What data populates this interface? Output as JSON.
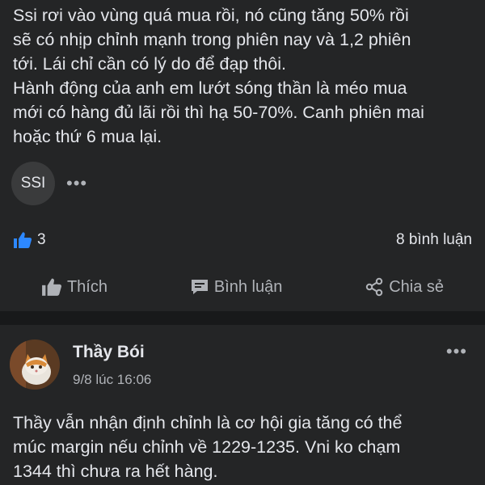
{
  "post1": {
    "text": "Ssi rơi vào vùng quá mua rồi, nó cũng tăng 50% rồi\nsẽ có nhịp chỉnh mạnh trong phiên nay và 1,2 phiên\ntới. Lái chỉ cần có lý do để đạp thôi.\nHành động của anh em lướt sóng thần là méo mua\nmới có hàng đủ lãi rồi thì hạ 50-70%. Canh phiên mai\nhoặc thứ 6 mua lại.",
    "tag": "SSI",
    "more": "•••",
    "like_count": "3",
    "comment_count": "8 bình luận",
    "actions": {
      "like": "Thích",
      "comment": "Bình luận",
      "share": "Chia sẻ"
    }
  },
  "post2": {
    "author": "Thầy Bói",
    "time": "9/8 lúc 16:06",
    "more": "•••",
    "text": "Thầy vẫn nhận định chỉnh là cơ hội gia tăng có thể\nmúc margin nếu chỉnh về 1229-1235. Vni ko chạm\n1344 thì chưa ra hết hàng."
  },
  "colors": {
    "background": "#18191a",
    "card": "#242526",
    "text": "#e4e6eb",
    "muted": "#b0b3b8",
    "like_blue": "#2d88ff"
  },
  "icons": [
    "like-icon",
    "thumbs-up-icon",
    "comment-icon",
    "share-icon",
    "more-icon"
  ]
}
